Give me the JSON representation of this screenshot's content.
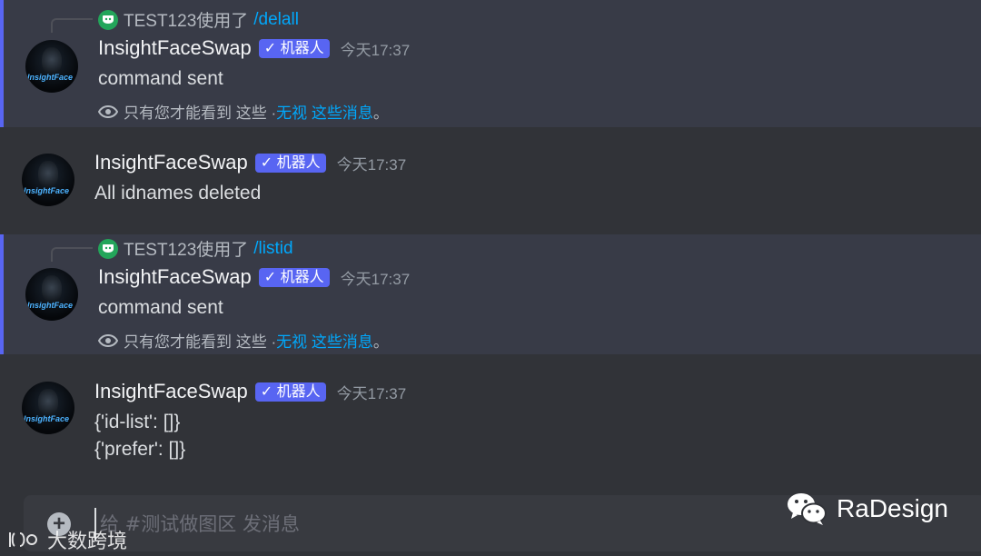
{
  "colors": {
    "background": "#313338",
    "ephemeral_bg": "#383b47",
    "accent": "#5865f2",
    "link": "#00a8fc",
    "app_icon": "#23a55a"
  },
  "messages": [
    {
      "reply": {
        "user_command_prefix": "TEST123使用了",
        "command": "/delall"
      },
      "username": "InsightFaceSwap",
      "badge": "✓ 机器人",
      "timestamp": "今天17:37",
      "lines": [
        "command sent"
      ],
      "ephemeral": {
        "text": "只有您才能看到 这些 · ",
        "link": "无视 这些消息",
        "suffix": "。"
      }
    },
    {
      "username": "InsightFaceSwap",
      "badge": "✓ 机器人",
      "timestamp": "今天17:37",
      "lines": [
        "All idnames deleted"
      ]
    },
    {
      "reply": {
        "user_command_prefix": "TEST123使用了",
        "command": "/listid"
      },
      "username": "InsightFaceSwap",
      "badge": "✓ 机器人",
      "timestamp": "今天17:37",
      "lines": [
        "command sent"
      ],
      "ephemeral": {
        "text": "只有您才能看到 这些 · ",
        "link": "无视 这些消息",
        "suffix": "。"
      }
    },
    {
      "username": "InsightFaceSwap",
      "badge": "✓ 机器人",
      "timestamp": "今天17:37",
      "lines": [
        "{'id-list': []}",
        "{'prefer': []}"
      ]
    }
  ],
  "avatar_text": "InsightFace",
  "composer": {
    "placeholder": "给 #测试做图区 发消息"
  },
  "watermarks": {
    "left": "大数跨境",
    "right": "RaDesign"
  }
}
